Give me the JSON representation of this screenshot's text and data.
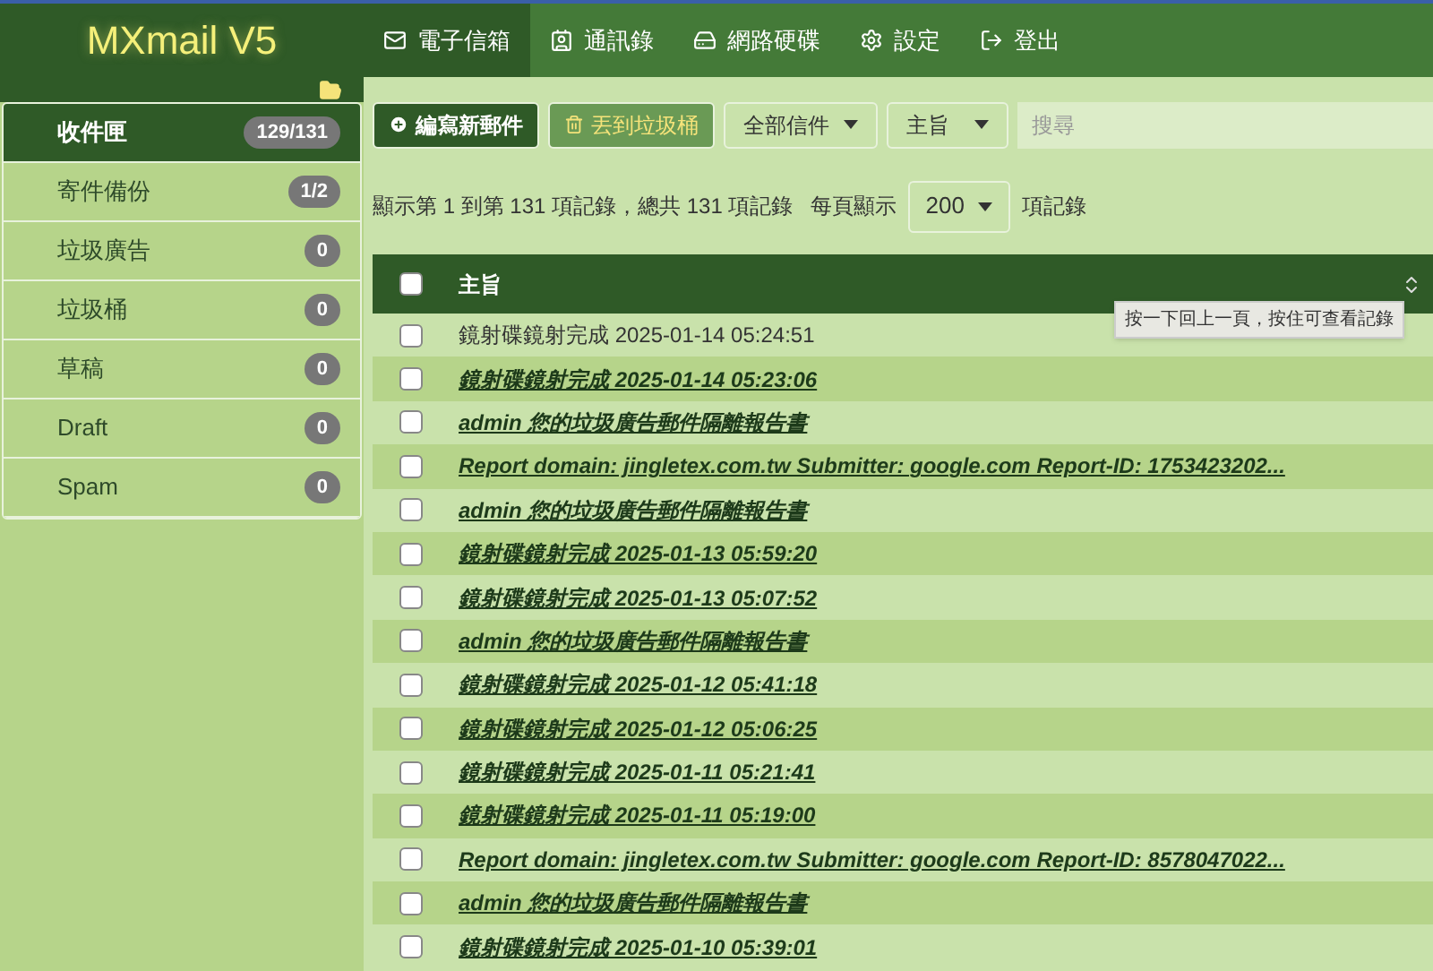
{
  "logo": "MXmail V5",
  "nav": [
    {
      "label": "電子信箱",
      "kind": "mail",
      "selected": true
    },
    {
      "label": "通訊錄",
      "kind": "contact",
      "selected": false
    },
    {
      "label": "網路硬碟",
      "kind": "drive",
      "selected": false
    },
    {
      "label": "設定",
      "kind": "gear",
      "selected": false
    },
    {
      "label": "登出",
      "kind": "logout",
      "selected": false
    }
  ],
  "folders": [
    {
      "name": "收件匣",
      "count": "129/131",
      "selected": true
    },
    {
      "name": "寄件備份",
      "count": "1/2",
      "selected": false
    },
    {
      "name": "垃圾廣告",
      "count": "0",
      "selected": false
    },
    {
      "name": "垃圾桶",
      "count": "0",
      "selected": false
    },
    {
      "name": "草稿",
      "count": "0",
      "selected": false
    },
    {
      "name": "Draft",
      "count": "0",
      "selected": false
    },
    {
      "name": "Spam",
      "count": "0",
      "selected": false
    }
  ],
  "toolbar": {
    "compose": "編寫新郵件",
    "trash": "丟到垃圾桶",
    "filter": "全部信件",
    "field": "主旨",
    "search_placeholder": "搜尋"
  },
  "paging": {
    "summary": "顯示第 1 到第 131 項記錄，總共 131 項記錄",
    "per_page_label": "每頁顯示",
    "per_page": "200",
    "suffix": "項記錄"
  },
  "table": {
    "header": "主旨",
    "select_all_checked": false,
    "rows": [
      {
        "subject": "鏡射碟鏡射完成 2025-01-14 05:24:51",
        "unread": false,
        "checked": false
      },
      {
        "subject": "鏡射碟鏡射完成 2025-01-14 05:23:06",
        "unread": true,
        "checked": false
      },
      {
        "subject": "admin 您的垃圾廣告郵件隔離報告書",
        "unread": true,
        "checked": false
      },
      {
        "subject": "Report domain: jingletex.com.tw Submitter: google.com Report-ID: 1753423202...",
        "unread": true,
        "checked": false
      },
      {
        "subject": "admin 您的垃圾廣告郵件隔離報告書",
        "unread": true,
        "checked": false
      },
      {
        "subject": "鏡射碟鏡射完成 2025-01-13 05:59:20",
        "unread": true,
        "checked": false
      },
      {
        "subject": "鏡射碟鏡射完成 2025-01-13 05:07:52",
        "unread": true,
        "checked": false
      },
      {
        "subject": "admin 您的垃圾廣告郵件隔離報告書",
        "unread": true,
        "checked": false
      },
      {
        "subject": "鏡射碟鏡射完成 2025-01-12 05:41:18",
        "unread": true,
        "checked": false
      },
      {
        "subject": "鏡射碟鏡射完成 2025-01-12 05:06:25",
        "unread": true,
        "checked": false
      },
      {
        "subject": "鏡射碟鏡射完成 2025-01-11 05:21:41",
        "unread": true,
        "checked": false
      },
      {
        "subject": "鏡射碟鏡射完成 2025-01-11 05:19:00",
        "unread": true,
        "checked": false
      },
      {
        "subject": "Report domain: jingletex.com.tw Submitter: google.com Report-ID: 8578047022...",
        "unread": true,
        "checked": false
      },
      {
        "subject": "admin 您的垃圾廣告郵件隔離報告書",
        "unread": true,
        "checked": false
      },
      {
        "subject": "鏡射碟鏡射完成 2025-01-10 05:39:01",
        "unread": true,
        "checked": false
      }
    ]
  },
  "tooltip": "按一下回上一頁，按住可查看記錄"
}
